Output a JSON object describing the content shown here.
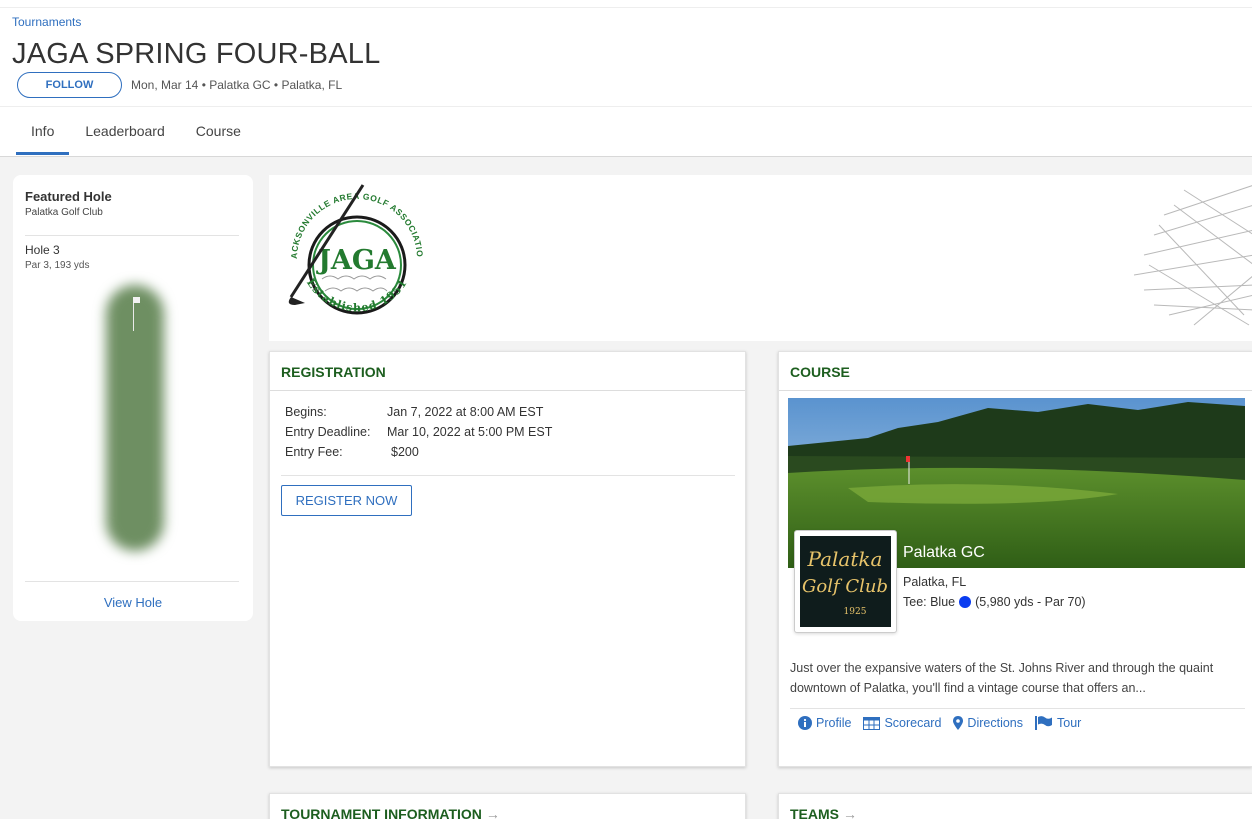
{
  "breadcrumb": "Tournaments",
  "title": "JAGA SPRING FOUR-BALL",
  "follow_label": "FOLLOW",
  "meta": "Mon, Mar 14 • Palatka GC • Palatka, FL",
  "tabs": [
    {
      "label": "Info",
      "active": true
    },
    {
      "label": "Leaderboard",
      "active": false
    },
    {
      "label": "Course",
      "active": false
    }
  ],
  "featured_hole": {
    "title": "Featured Hole",
    "club": "Palatka Golf Club",
    "hole": "Hole 3",
    "info": "Par 3, 193 yds",
    "link": "View Hole"
  },
  "banner": {
    "logo_top_text": "JACKSONVILLE AREA GOLF ASSOCIATION",
    "logo_center_text": "JAGA",
    "logo_bottom_text": "Established 1951"
  },
  "registration": {
    "title": "REGISTRATION",
    "rows": [
      {
        "label": "Begins:",
        "value": "Jan 7, 2022 at 8:00 AM EST"
      },
      {
        "label": "Entry Deadline:",
        "value": "Mar 10, 2022 at 5:00 PM EST"
      },
      {
        "label": "Entry Fee:",
        "value": "$200"
      }
    ],
    "button": "REGISTER NOW"
  },
  "course": {
    "title": "COURSE",
    "name": "Palatka GC",
    "city": "Palatka, FL",
    "tee_prefix": "Tee: Blue",
    "tee_color": "#0a3cf0",
    "tee_info": "(5,980 yds - Par 70)",
    "logo_text": [
      "Palatka",
      "Golf Club",
      "1925"
    ],
    "description": "Just over the expansive waters of the St. Johns River and through the quaint downtown of Palatka, you'll find a vintage course that offers an...",
    "links": [
      {
        "label": "Profile",
        "icon": "info-circle-icon"
      },
      {
        "label": "Scorecard",
        "icon": "table-icon"
      },
      {
        "label": "Directions",
        "icon": "map-marker-icon"
      },
      {
        "label": "Tour",
        "icon": "flag-icon"
      }
    ]
  },
  "sections": {
    "tournament_info": "TOURNAMENT INFORMATION",
    "teams": "TEAMS"
  },
  "colors": {
    "accent": "#2f6fbf",
    "section_title": "#1d5e1f",
    "background": "#f3f3f3"
  }
}
